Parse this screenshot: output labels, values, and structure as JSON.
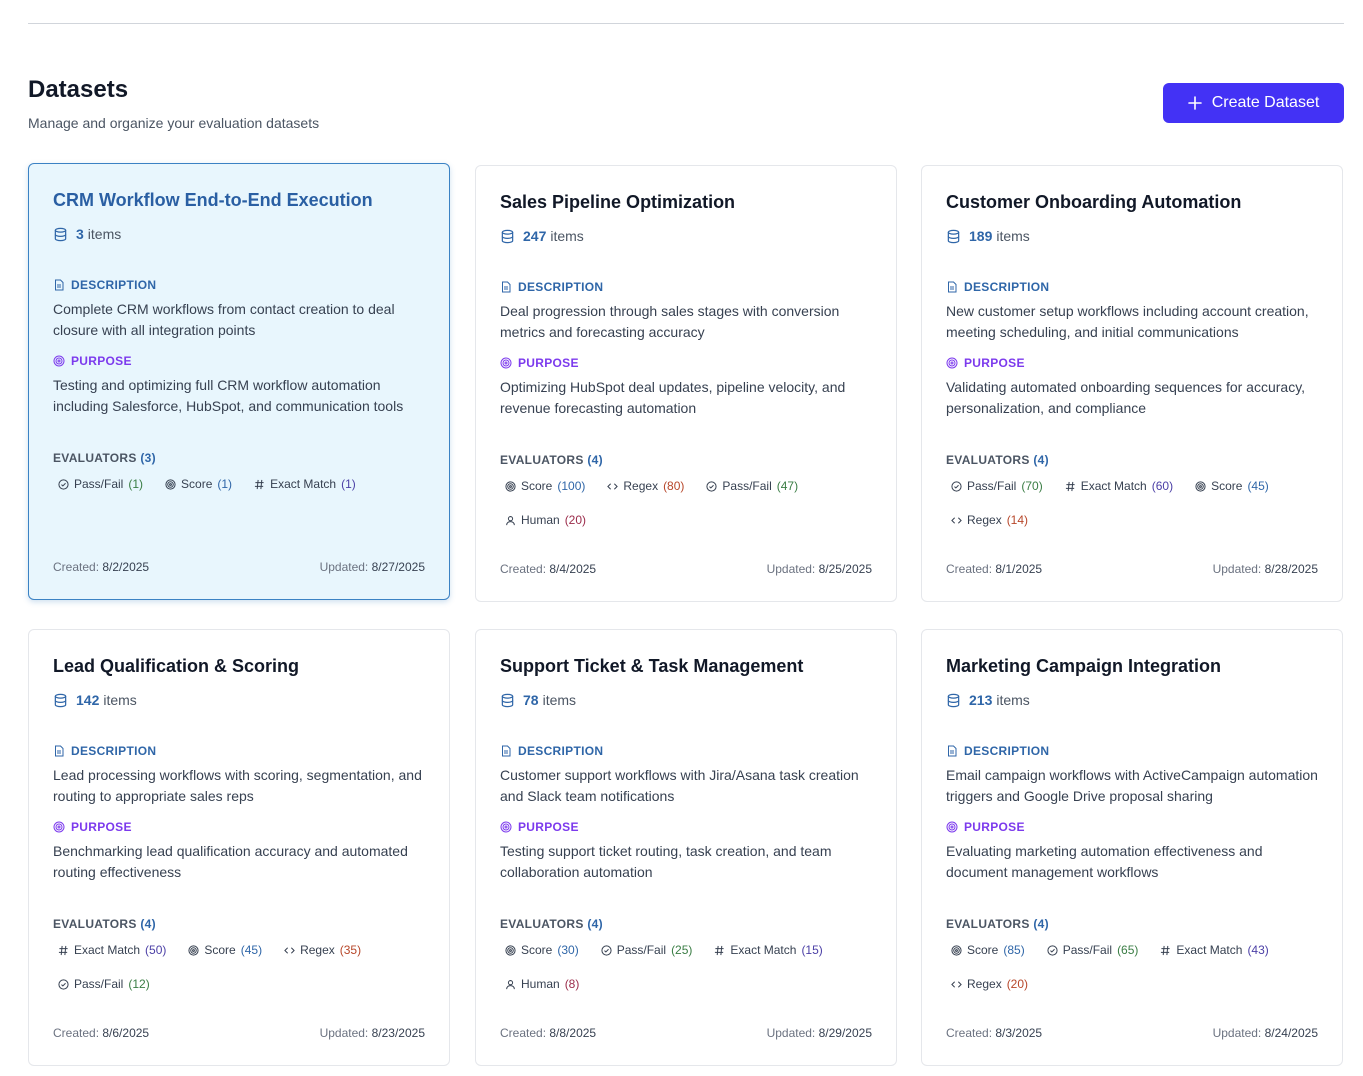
{
  "header": {
    "title": "Datasets",
    "subtitle": "Manage and organize your evaluation datasets",
    "create_label": "Create Dataset"
  },
  "labels": {
    "items": "items",
    "description": "DESCRIPTION",
    "purpose": "PURPOSE",
    "evaluators": "EVALUATORS",
    "created": "Created:",
    "updated": "Updated:"
  },
  "colors": {
    "primary": "#4332f5",
    "selected_bg": "#e8f6fd",
    "count_blue": "#2f66a8",
    "purpose_purple": "#7c3aed",
    "score_blue": "#2f66a8",
    "regex_red": "#b7472a",
    "passfail_green": "#3a7d44",
    "exact_purple": "#4b3fa6",
    "human_maroon": "#9b2c4b"
  },
  "datasets": [
    {
      "title": "CRM Workflow End-to-End Execution",
      "items": "3",
      "description": "Complete CRM workflows from contact creation to deal closure with all integration points",
      "purpose": "Testing and optimizing full CRM workflow automation including Salesforce, HubSpot, and communication tools",
      "evaluator_count": "(3)",
      "evaluators": [
        {
          "icon": "check-circle-icon",
          "name": "Pass/Fail",
          "count": "(1)",
          "type": "passfail"
        },
        {
          "icon": "target-icon",
          "name": "Score",
          "count": "(1)",
          "type": "score"
        },
        {
          "icon": "hash-icon",
          "name": "Exact Match",
          "count": "(1)",
          "type": "exact"
        }
      ],
      "created": "8/2/2025",
      "updated": "8/27/2025",
      "selected": true
    },
    {
      "title": "Sales Pipeline Optimization",
      "items": "247",
      "description": "Deal progression through sales stages with conversion metrics and forecasting accuracy",
      "purpose": "Optimizing HubSpot deal updates, pipeline velocity, and revenue forecasting automation",
      "evaluator_count": "(4)",
      "evaluators": [
        {
          "icon": "target-icon",
          "name": "Score",
          "count": "(100)",
          "type": "score"
        },
        {
          "icon": "code-icon",
          "name": "Regex",
          "count": "(80)",
          "type": "regex"
        },
        {
          "icon": "check-circle-icon",
          "name": "Pass/Fail",
          "count": "(47)",
          "type": "passfail"
        },
        {
          "icon": "user-icon",
          "name": "Human",
          "count": "(20)",
          "type": "human"
        }
      ],
      "created": "8/4/2025",
      "updated": "8/25/2025",
      "selected": false
    },
    {
      "title": "Customer Onboarding Automation",
      "items": "189",
      "description": "New customer setup workflows including account creation, meeting scheduling, and initial communications",
      "purpose": "Validating automated onboarding sequences for accuracy, personalization, and compliance",
      "evaluator_count": "(4)",
      "evaluators": [
        {
          "icon": "check-circle-icon",
          "name": "Pass/Fail",
          "count": "(70)",
          "type": "passfail"
        },
        {
          "icon": "hash-icon",
          "name": "Exact Match",
          "count": "(60)",
          "type": "exact"
        },
        {
          "icon": "target-icon",
          "name": "Score",
          "count": "(45)",
          "type": "score"
        },
        {
          "icon": "code-icon",
          "name": "Regex",
          "count": "(14)",
          "type": "regex"
        }
      ],
      "created": "8/1/2025",
      "updated": "8/28/2025",
      "selected": false
    },
    {
      "title": "Lead Qualification & Scoring",
      "items": "142",
      "description": "Lead processing workflows with scoring, segmentation, and routing to appropriate sales reps",
      "purpose": "Benchmarking lead qualification accuracy and automated routing effectiveness",
      "evaluator_count": "(4)",
      "evaluators": [
        {
          "icon": "hash-icon",
          "name": "Exact Match",
          "count": "(50)",
          "type": "exact"
        },
        {
          "icon": "target-icon",
          "name": "Score",
          "count": "(45)",
          "type": "score"
        },
        {
          "icon": "code-icon",
          "name": "Regex",
          "count": "(35)",
          "type": "regex"
        },
        {
          "icon": "check-circle-icon",
          "name": "Pass/Fail",
          "count": "(12)",
          "type": "passfail"
        }
      ],
      "created": "8/6/2025",
      "updated": "8/23/2025",
      "selected": false
    },
    {
      "title": "Support Ticket & Task Management",
      "items": "78",
      "description": "Customer support workflows with Jira/Asana task creation and Slack team notifications",
      "purpose": "Testing support ticket routing, task creation, and team collaboration automation",
      "evaluator_count": "(4)",
      "evaluators": [
        {
          "icon": "target-icon",
          "name": "Score",
          "count": "(30)",
          "type": "score"
        },
        {
          "icon": "check-circle-icon",
          "name": "Pass/Fail",
          "count": "(25)",
          "type": "passfail"
        },
        {
          "icon": "hash-icon",
          "name": "Exact Match",
          "count": "(15)",
          "type": "exact"
        },
        {
          "icon": "user-icon",
          "name": "Human",
          "count": "(8)",
          "type": "human"
        }
      ],
      "created": "8/8/2025",
      "updated": "8/29/2025",
      "selected": false
    },
    {
      "title": "Marketing Campaign Integration",
      "items": "213",
      "description": "Email campaign workflows with ActiveCampaign automation triggers and Google Drive proposal sharing",
      "purpose": "Evaluating marketing automation effectiveness and document management workflows",
      "evaluator_count": "(4)",
      "evaluators": [
        {
          "icon": "target-icon",
          "name": "Score",
          "count": "(85)",
          "type": "score"
        },
        {
          "icon": "check-circle-icon",
          "name": "Pass/Fail",
          "count": "(65)",
          "type": "passfail"
        },
        {
          "icon": "hash-icon",
          "name": "Exact Match",
          "count": "(43)",
          "type": "exact"
        },
        {
          "icon": "code-icon",
          "name": "Regex",
          "count": "(20)",
          "type": "regex"
        }
      ],
      "created": "8/3/2025",
      "updated": "8/24/2025",
      "selected": false
    }
  ]
}
